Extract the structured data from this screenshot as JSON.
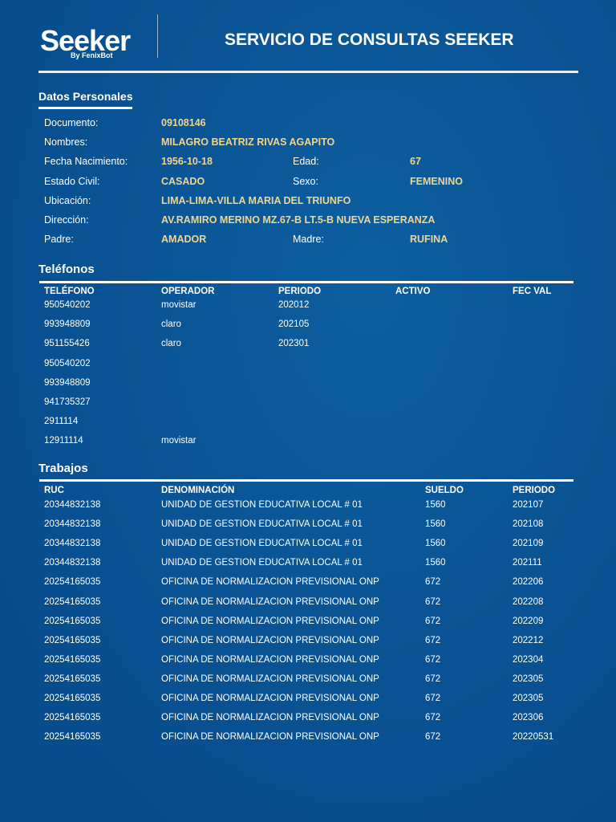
{
  "header": {
    "logo": "Seeker",
    "logo_sub": "By FenixBot",
    "title": "SERVICIO DE CONSULTAS SEEKER"
  },
  "personal": {
    "title": "Datos Personales",
    "rows": [
      {
        "label": "Documento:",
        "value": "09108146"
      },
      {
        "label": "Nombres:",
        "value": "MILAGRO BEATRIZ RIVAS AGAPITO"
      },
      {
        "label": "Fecha Nacimiento:",
        "value": "1956-10-18",
        "label2": "Edad:",
        "value2": "67"
      },
      {
        "label": "Estado Civil:",
        "value": "CASADO",
        "label2": "Sexo:",
        "value2": "FEMENINO"
      },
      {
        "label": "Ubicación:",
        "value": "LIMA-LIMA-VILLA MARIA DEL TRIUNFO"
      },
      {
        "label": "Dirección:",
        "value": "AV.RAMIRO MERINO MZ.67-B LT.5-B NUEVA ESPERANZA"
      },
      {
        "label": "Padre:",
        "value": "AMADOR",
        "label2": "Madre:",
        "value2": "RUFINA"
      }
    ]
  },
  "phones": {
    "title": "Teléfonos",
    "headers": [
      "TELÉFONO",
      "OPERADOR",
      "PERIODO",
      "ACTIVO",
      "FEC VAL"
    ],
    "rows": [
      [
        "950540202",
        "movistar",
        "202012",
        "",
        ""
      ],
      [
        "993948809",
        "claro",
        "202105",
        "",
        ""
      ],
      [
        "951155426",
        "claro",
        "202301",
        "",
        ""
      ],
      [
        "950540202",
        "",
        "",
        "",
        ""
      ],
      [
        "993948809",
        "",
        "",
        "",
        ""
      ],
      [
        "941735327",
        "",
        "",
        "",
        ""
      ],
      [
        "2911114",
        "",
        "",
        "",
        ""
      ],
      [
        "12911114",
        "movistar",
        "",
        "",
        ""
      ]
    ]
  },
  "jobs": {
    "title": "Trabajos",
    "headers": [
      "RUC",
      "DENOMINACIÓN",
      "SUELDO",
      "PERIODO"
    ],
    "rows": [
      [
        "20344832138",
        "UNIDAD DE GESTION EDUCATIVA LOCAL # 01",
        "1560",
        "202107"
      ],
      [
        "20344832138",
        "UNIDAD DE GESTION EDUCATIVA LOCAL # 01",
        "1560",
        "202108"
      ],
      [
        "20344832138",
        "UNIDAD DE GESTION EDUCATIVA LOCAL # 01",
        "1560",
        "202109"
      ],
      [
        "20344832138",
        "UNIDAD DE GESTION EDUCATIVA LOCAL # 01",
        "1560",
        "202111"
      ],
      [
        "20254165035",
        "OFICINA DE NORMALIZACION PREVISIONAL ONP",
        "672",
        "202206"
      ],
      [
        "20254165035",
        "OFICINA DE NORMALIZACION PREVISIONAL ONP",
        "672",
        "202208"
      ],
      [
        "20254165035",
        "OFICINA DE NORMALIZACION PREVISIONAL ONP",
        "672",
        "202209"
      ],
      [
        "20254165035",
        "OFICINA DE NORMALIZACION PREVISIONAL ONP",
        "672",
        "202212"
      ],
      [
        "20254165035",
        "OFICINA DE NORMALIZACION PREVISIONAL ONP",
        "672",
        "202304"
      ],
      [
        "20254165035",
        "OFICINA DE NORMALIZACION PREVISIONAL ONP",
        "672",
        "202305"
      ],
      [
        "20254165035",
        "OFICINA DE NORMALIZACION PREVISIONAL ONP",
        "672",
        "202305"
      ],
      [
        "20254165035",
        "OFICINA DE NORMALIZACION PREVISIONAL ONP",
        "672",
        "202306"
      ],
      [
        "20254165035",
        "OFICINA DE NORMALIZACION PREVISIONAL ONP",
        "672",
        "20220531"
      ]
    ]
  }
}
